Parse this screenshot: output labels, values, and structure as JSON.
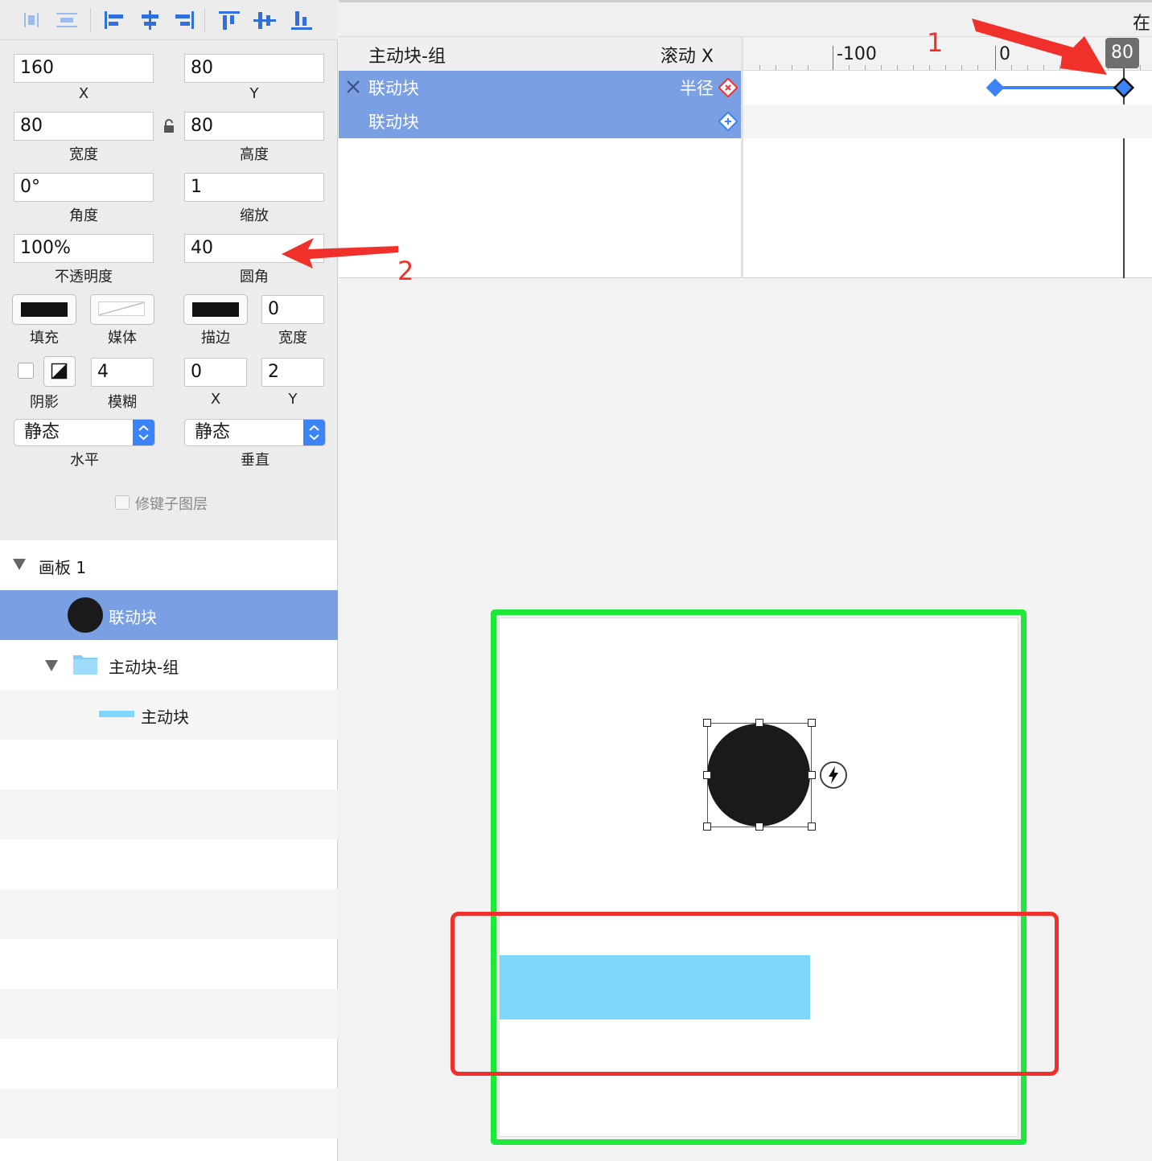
{
  "toolbar": {
    "icons": [
      "distribute-horizontal-icon",
      "distribute-vertical-icon",
      "align-left-icon",
      "align-center-horizontal-icon",
      "align-right-icon",
      "align-top-icon",
      "align-middle-vertical-icon",
      "align-bottom-icon"
    ]
  },
  "inspector": {
    "x": {
      "value": "160",
      "label": "X"
    },
    "y": {
      "value": "80",
      "label": "Y"
    },
    "width": {
      "value": "80",
      "label": "宽度"
    },
    "height": {
      "value": "80",
      "label": "高度"
    },
    "angle": {
      "value": "0°",
      "label": "角度"
    },
    "scale": {
      "value": "1",
      "label": "缩放"
    },
    "opacity": {
      "value": "100%",
      "label": "不透明度"
    },
    "radius": {
      "value": "40",
      "label": "圆角"
    },
    "fill_label": "填充",
    "media_label": "媒体",
    "stroke_label": "描边",
    "stroke_width": {
      "value": "0",
      "label": "宽度"
    },
    "shadow_label": "阴影",
    "blur": {
      "value": "4",
      "label": "模糊"
    },
    "shadow_x": {
      "value": "0",
      "label": "X"
    },
    "shadow_y": {
      "value": "2",
      "label": "Y"
    },
    "horizontal": {
      "value": "静态",
      "label": "水平"
    },
    "vertical": {
      "value": "静态",
      "label": "垂直"
    },
    "modifier_label": "修键子图层"
  },
  "layers": {
    "board": "画板 1",
    "items": [
      {
        "label": "联动块",
        "selected": true
      },
      {
        "label": "主动块-组"
      },
      {
        "label": "主动块"
      }
    ]
  },
  "timeline": {
    "top_right_text": "在",
    "group_label": "主动块-组",
    "group_prop": "滚动 X",
    "props": [
      {
        "label": "联动块",
        "prop": "半径"
      },
      {
        "label": "联动块",
        "prop": ""
      }
    ],
    "ruler": {
      "minus100": "-100",
      "zero": "0",
      "current": "80"
    }
  },
  "annotations": {
    "one": "1",
    "two": "2",
    "colors": {
      "arrow": "#f0302a",
      "green_box": "#1ee83a",
      "red_box": "#f0302a"
    }
  },
  "colors": {
    "selection": "#7a9fe3",
    "accent": "#3b83f6",
    "bar": "#7fd8fb",
    "circle": "#1a1a1a"
  }
}
